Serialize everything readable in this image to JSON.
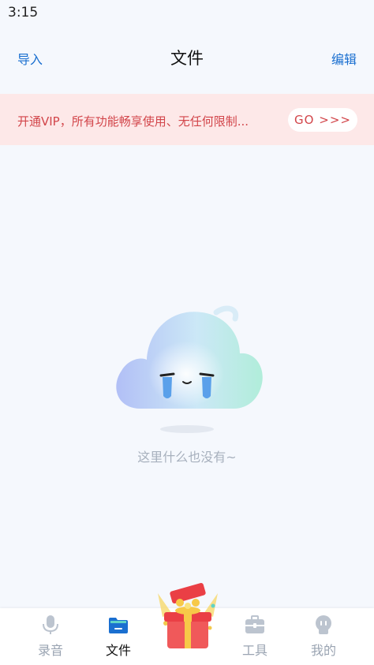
{
  "status_bar": {
    "time": "3:15"
  },
  "header": {
    "import_label": "导入",
    "title": "文件",
    "edit_label": "编辑"
  },
  "vip_banner": {
    "text": "开通VIP，所有功能畅享使用、无任何限制...",
    "go_label": "GO >>>"
  },
  "empty_state": {
    "text": "这里什么也没有~"
  },
  "tab_bar": {
    "tabs": [
      {
        "label": "录音",
        "icon": "microphone-icon",
        "active": false
      },
      {
        "label": "文件",
        "icon": "folder-icon",
        "active": true
      },
      {
        "label": "工具",
        "icon": "toolbox-icon",
        "active": false
      },
      {
        "label": "我的",
        "icon": "profile-icon",
        "active": false
      }
    ],
    "center_icon": "gift-box-icon"
  },
  "colors": {
    "accent_blue": "#1a6fd0",
    "vip_red": "#d2454a",
    "vip_bg": "#fde8e8",
    "background": "#f5f8fd"
  }
}
